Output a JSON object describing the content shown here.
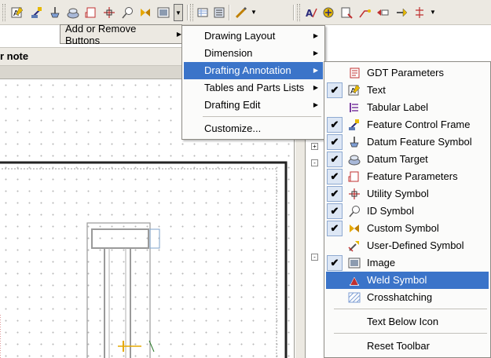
{
  "toolbar": {
    "add_remove_label": "Add or Remove Buttons"
  },
  "left_panel": {
    "header_label": "r note"
  },
  "menu_main": {
    "items": [
      {
        "label": "Drawing Layout"
      },
      {
        "label": "Dimension"
      },
      {
        "label": "Drafting Annotation"
      },
      {
        "label": "Tables and Parts Lists"
      },
      {
        "label": "Drafting Edit"
      },
      {
        "label": "Customize..."
      }
    ]
  },
  "menu_annotation": {
    "items": [
      {
        "label": "GDT Parameters",
        "icon": "gdt-parameters-icon",
        "checked": false
      },
      {
        "label": "Text",
        "icon": "text-icon",
        "checked": true
      },
      {
        "label": "Tabular Label",
        "icon": "tabular-label-icon",
        "checked": false
      },
      {
        "label": "Feature Control Frame",
        "icon": "feature-control-frame-icon",
        "checked": true
      },
      {
        "label": "Datum Feature Symbol",
        "icon": "datum-feature-symbol-icon",
        "checked": true
      },
      {
        "label": "Datum Target",
        "icon": "datum-target-icon",
        "checked": true
      },
      {
        "label": "Feature Parameters",
        "icon": "feature-parameters-icon",
        "checked": true
      },
      {
        "label": "Utility Symbol",
        "icon": "utility-symbol-icon",
        "checked": true
      },
      {
        "label": "ID Symbol",
        "icon": "id-symbol-icon",
        "checked": true
      },
      {
        "label": "Custom Symbol",
        "icon": "custom-symbol-icon",
        "checked": true
      },
      {
        "label": "User-Defined Symbol",
        "icon": "user-defined-symbol-icon",
        "checked": false
      },
      {
        "label": "Image",
        "icon": "image-icon",
        "checked": true
      },
      {
        "label": "Weld Symbol",
        "icon": "weld-symbol-icon",
        "checked": false
      },
      {
        "label": "Crosshatching",
        "icon": "crosshatching-icon",
        "checked": false
      },
      {
        "label": "Text Below Icon"
      },
      {
        "label": "Reset Toolbar"
      }
    ]
  },
  "colors": {
    "highlight": "#3b74c9",
    "check_bg": "#dde7f5",
    "toolbar_bg": "#ece9e2"
  }
}
